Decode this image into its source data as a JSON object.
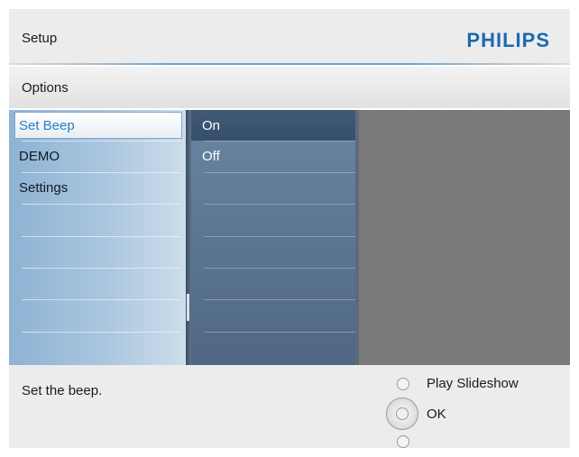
{
  "header": {
    "title": "Setup",
    "brand": "PHILIPS"
  },
  "options": {
    "label": "Options"
  },
  "menu": {
    "items": [
      {
        "label": "Set Beep"
      },
      {
        "label": "DEMO"
      },
      {
        "label": "Settings"
      }
    ]
  },
  "submenu": {
    "items": [
      {
        "label": "On"
      },
      {
        "label": "Off"
      }
    ]
  },
  "footer": {
    "hint": "Set the beep.",
    "play_label": "Play Slideshow",
    "ok_label": "OK"
  },
  "colors": {
    "brand": "#1c69b2",
    "selection_text": "#2a7dc4",
    "menu_panel": "#aac6df",
    "submenu_panel": "#5a7591"
  }
}
